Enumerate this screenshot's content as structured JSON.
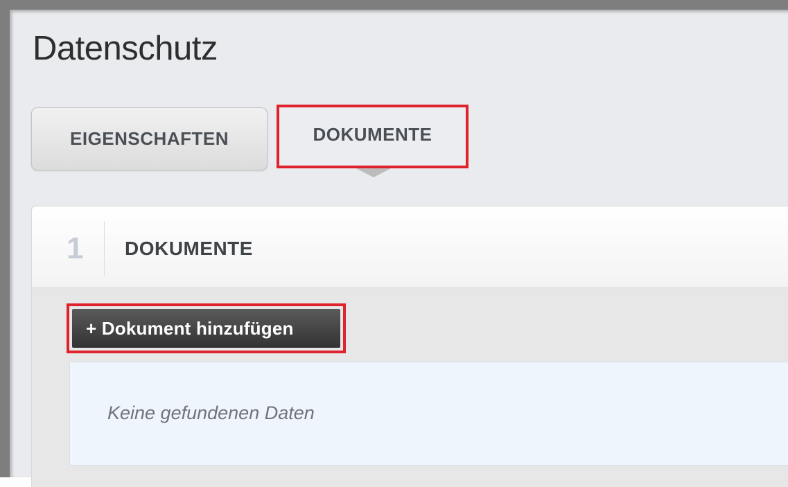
{
  "page": {
    "title": "Datenschutz"
  },
  "tabs": [
    {
      "label": "EIGENSCHAFTEN",
      "active": false
    },
    {
      "label": "DOKUMENTE",
      "active": true
    }
  ],
  "section": {
    "number": "1",
    "title": "DOKUMENTE"
  },
  "actions": {
    "add_document_label": "+ Dokument hinzufügen"
  },
  "documents": {
    "empty_message": "Keine gefundenen Daten"
  },
  "colors": {
    "highlight": "#e0222c",
    "button_bg": "#3f3f3f",
    "empty_bg": "#eef5fc"
  }
}
